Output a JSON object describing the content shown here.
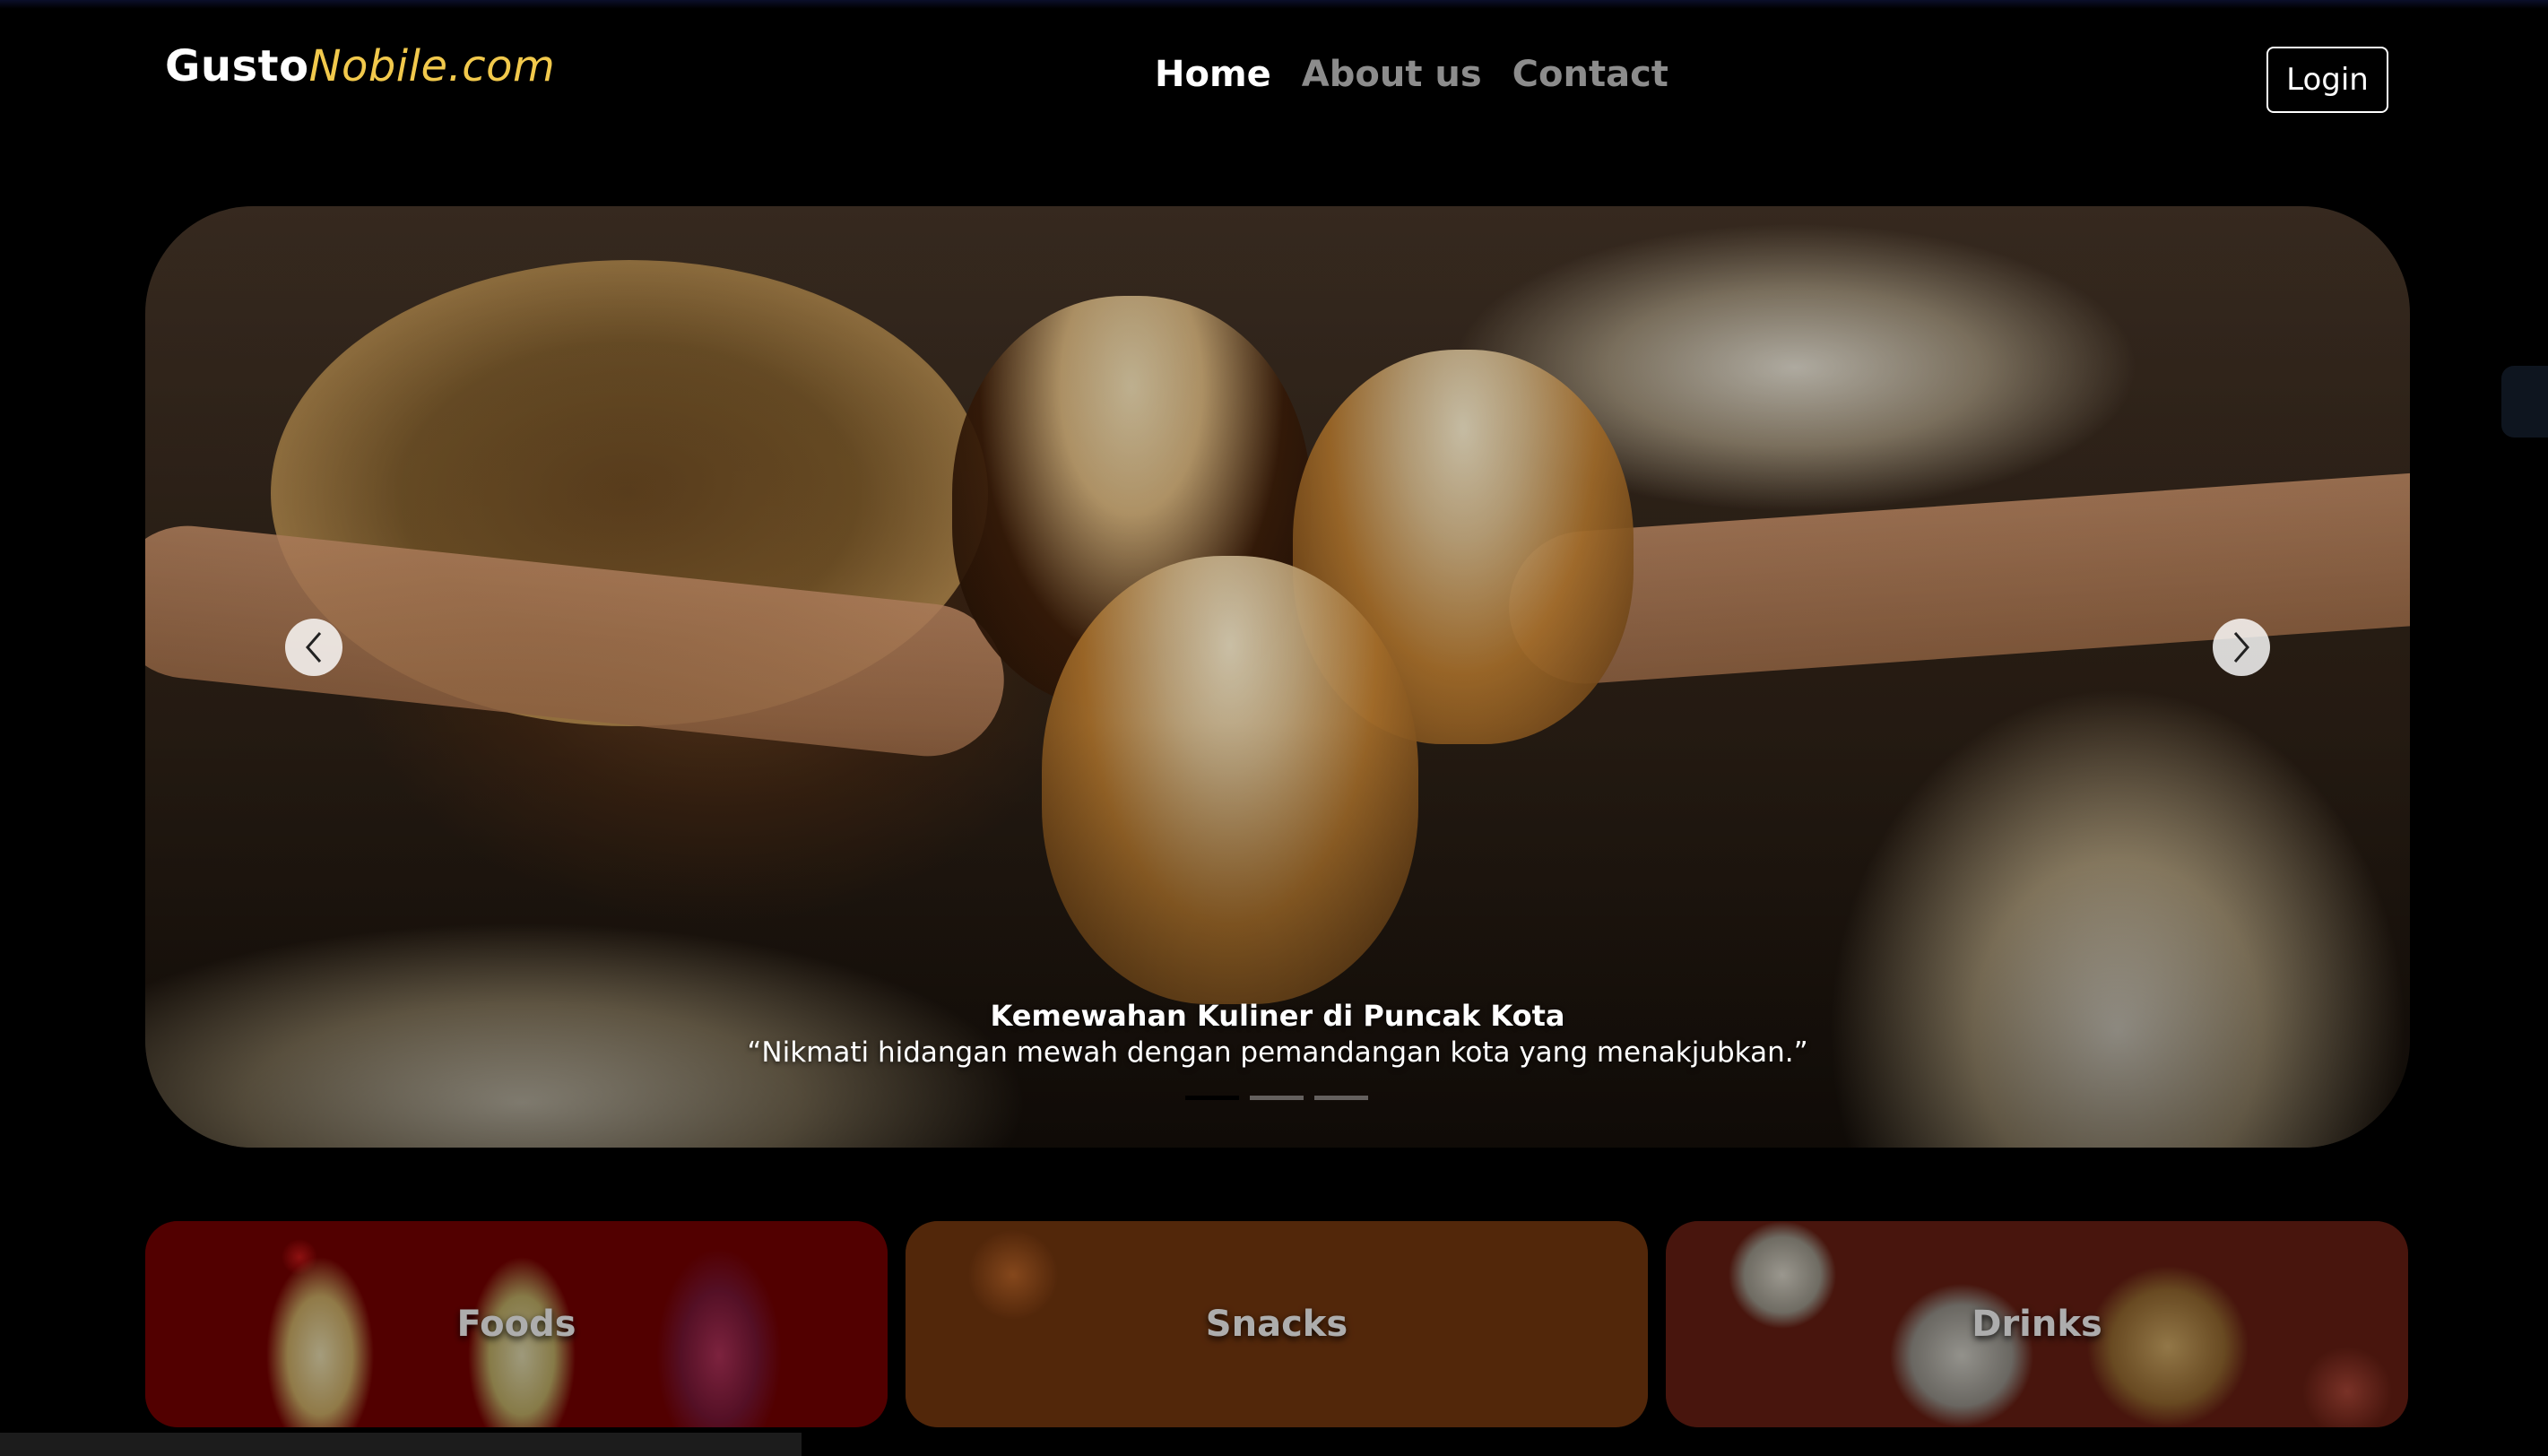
{
  "brand": {
    "part1": "Gusto",
    "part2": "Nobile.com",
    "accent_color": "#f2c94c"
  },
  "nav": {
    "items": [
      {
        "label": "Home",
        "active": true
      },
      {
        "label": "About us",
        "active": false
      },
      {
        "label": "Contact",
        "active": false
      }
    ]
  },
  "login_label": "Login",
  "hero": {
    "title": "Kemewahan Kuliner di Puncak Kota",
    "quote": "“Nikmati hidangan mewah dengan pemandangan kota yang menakjubkan.”",
    "active_slide": 1,
    "slide_count": 3,
    "prev_icon": "chevron-left-icon",
    "next_icon": "chevron-right-icon"
  },
  "categories": [
    {
      "label": "Foods"
    },
    {
      "label": "Snacks"
    },
    {
      "label": "Drinks"
    }
  ]
}
